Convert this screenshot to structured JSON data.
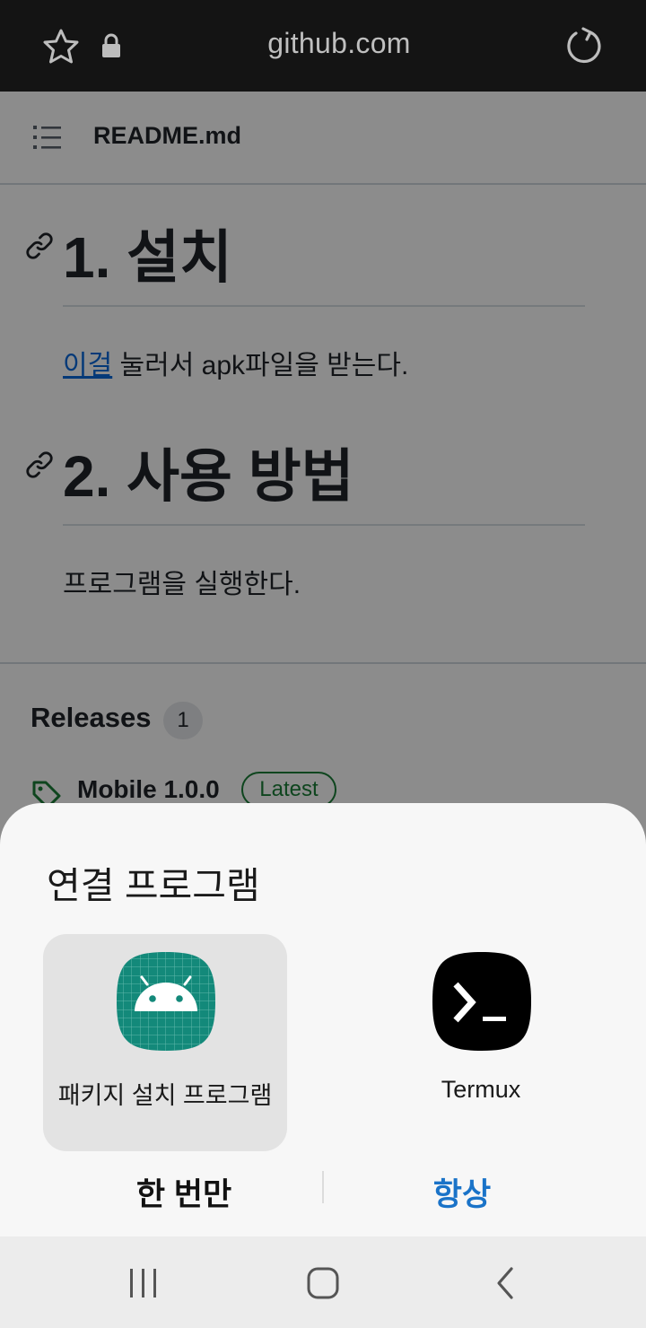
{
  "browser": {
    "url": "github.com",
    "icons": [
      "star-icon",
      "lock-icon",
      "reload-icon"
    ]
  },
  "readme": {
    "file_title": "README.md",
    "section1_heading": "1. 설치",
    "section1_link": "이걸",
    "section1_text": " 눌러서 apk파일을 받는다.",
    "section2_heading": "2. 사용 방법",
    "section2_text": "프로그램을 실행한다."
  },
  "releases": {
    "title": "Releases",
    "count": "1",
    "release_name": "Mobile 1.0.0",
    "latest_badge": "Latest"
  },
  "dialog": {
    "title": "연결 프로그램",
    "apps": [
      {
        "label": "패키지 설치 프로그램",
        "icon": "android-package-installer-icon",
        "selected": true
      },
      {
        "label": "Termux",
        "icon": "termux-icon",
        "selected": false
      }
    ],
    "once_label": "한 번만",
    "always_label": "항상"
  },
  "colors": {
    "accent_blue": "#1a73c8",
    "installer_green": "#13897a",
    "latest_green": "#1a7f37"
  },
  "navbar": {
    "icons": [
      "recent-apps-icon",
      "home-icon",
      "back-icon"
    ]
  }
}
